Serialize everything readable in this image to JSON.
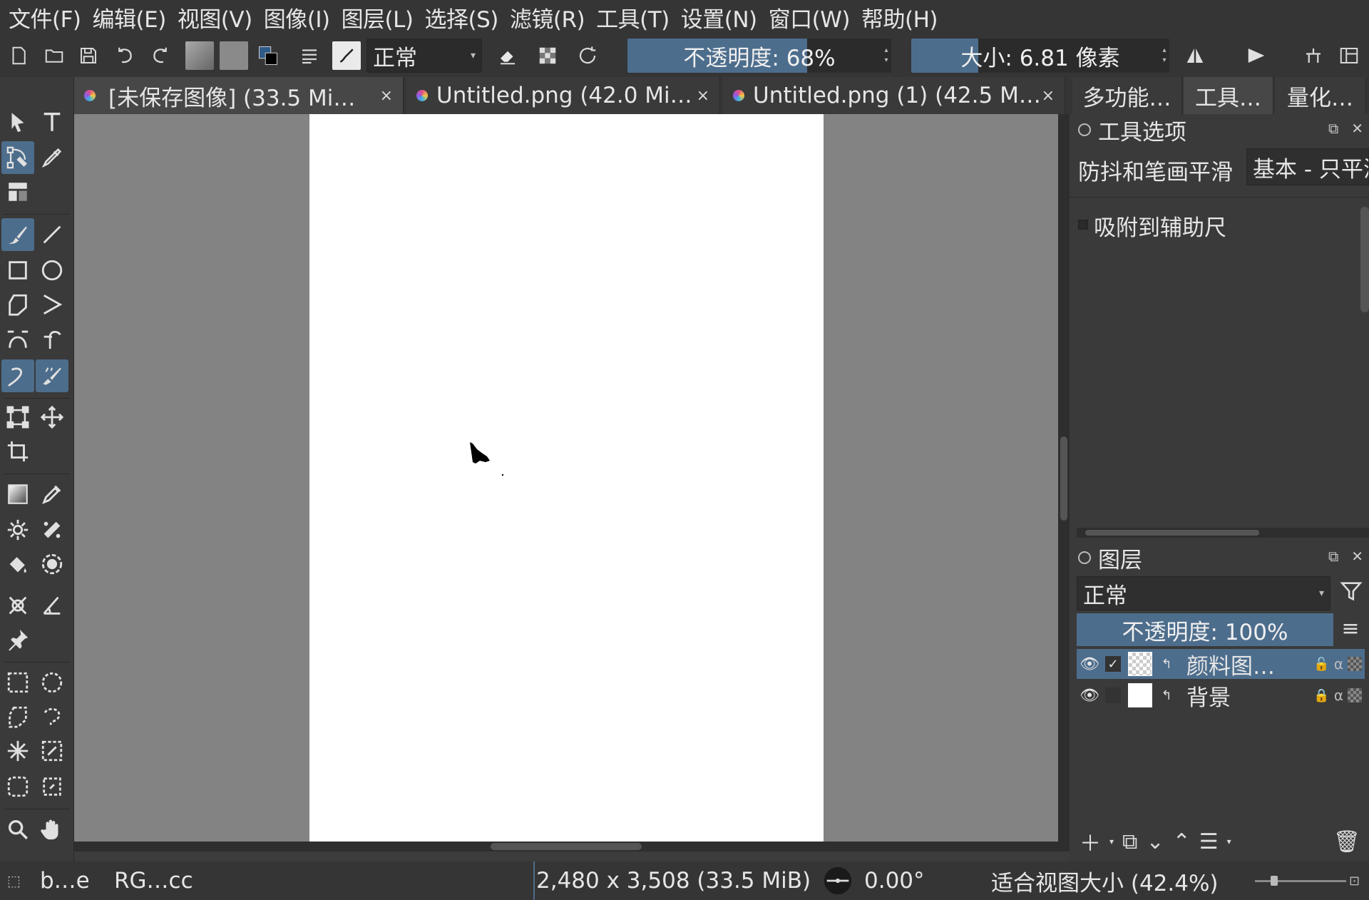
{
  "menu": [
    "文件(F)",
    "编辑(E)",
    "视图(V)",
    "图像(I)",
    "图层(L)",
    "选择(S)",
    "滤镜(R)",
    "工具(T)",
    "设置(N)",
    "窗口(W)",
    "帮助(H)"
  ],
  "toolbar": {
    "blend_mode": "正常",
    "opacity_label": "不透明度:  68%",
    "opacity_value": 0.68,
    "size_label": "大小:  6.81 像素",
    "size_fill": 0.26
  },
  "tabs": [
    {
      "label": "[未保存图像] (33.5 Mi…",
      "close": "×"
    },
    {
      "label": "Untitled.png (42.0 Mi…",
      "close": "×"
    },
    {
      "label": "Untitled.png (1) (42.5 M…",
      "close": "×"
    }
  ],
  "docker_tabs": [
    "多功能…",
    "工具…",
    "量化…"
  ],
  "tool_options": {
    "title": "工具选项",
    "stabilizer_label": "防抖和笔画平滑",
    "stabilizer_value": "基本 - 只平滑",
    "snap_label": "吸附到辅助尺"
  },
  "layers": {
    "title": "图层",
    "blend_mode": "正常",
    "opacity_label": "不透明度:  100%",
    "items": [
      {
        "name": "颜料图…",
        "selected": true,
        "checked": "✓"
      },
      {
        "name": "背景",
        "selected": false,
        "checked": ""
      }
    ]
  },
  "status": {
    "brush": "b…e",
    "color_profile": "RG…cc",
    "dimensions": "2,480 x 3,508 (33.5 MiB)",
    "rotation": "0.00°",
    "zoom": "适合视图大小 (42.4%)"
  },
  "colors": {
    "accent": "#4d6d8c",
    "panel": "#3a3a3a",
    "canvas_bg": "#838383",
    "paper": "#ffffff"
  }
}
